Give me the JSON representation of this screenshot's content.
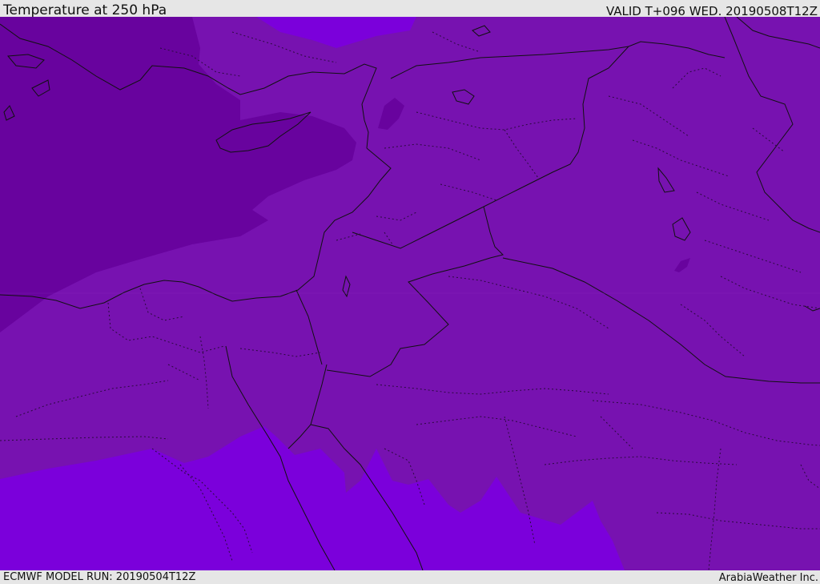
{
  "header": {
    "title": "Temperature at 250 hPa",
    "valid_time": "VALID T+096 WED. 20190508T12Z"
  },
  "footer": {
    "model_run": "ECMWF MODEL RUN: 20190504T12Z",
    "credit": "ArabiaWeather Inc."
  },
  "map": {
    "variable": "temperature",
    "level": "250 hPa",
    "colors": {
      "cold_zone": "#68039e",
      "mid_zone": "#7712b0",
      "warm_zone": "#7b00db",
      "warm_patch": "#7b0dd4",
      "coastline": "#111111",
      "borders_dotted": "#2a0a3d"
    }
  }
}
